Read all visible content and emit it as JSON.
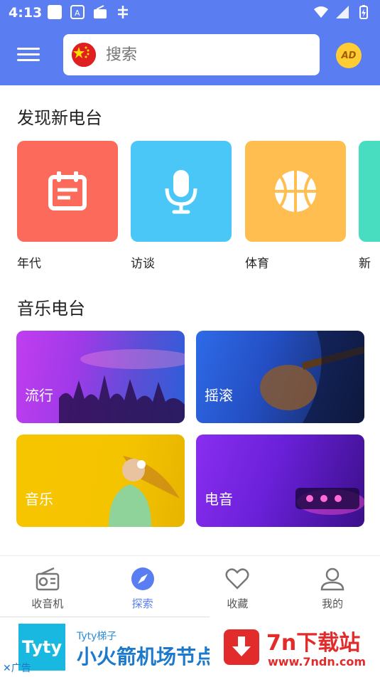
{
  "status_bar": {
    "time": "4:13"
  },
  "header": {
    "search_placeholder": "搜索",
    "ad_badge": "AD"
  },
  "discover": {
    "title": "发现新电台",
    "tiles": [
      {
        "label": "年代",
        "icon": "calendar-icon",
        "color": "#fb6a5b"
      },
      {
        "label": "访谈",
        "icon": "microphone-icon",
        "color": "#4bc7f7"
      },
      {
        "label": "体育",
        "icon": "basketball-icon",
        "color": "#ffbe4f"
      },
      {
        "label": "新闻",
        "icon": "news-icon",
        "color": "#48dcc0"
      }
    ]
  },
  "music": {
    "title": "音乐电台",
    "cards": [
      {
        "label": "流行"
      },
      {
        "label": "摇滚"
      },
      {
        "label": "音乐"
      },
      {
        "label": "电音"
      }
    ]
  },
  "bottom_nav": {
    "items": [
      {
        "label": "收音机",
        "icon": "radio-icon"
      },
      {
        "label": "探索",
        "icon": "compass-icon",
        "active": true
      },
      {
        "label": "收藏",
        "icon": "heart-icon"
      },
      {
        "label": "我的",
        "icon": "user-icon"
      }
    ]
  },
  "ad": {
    "logo": "Tyty",
    "small_text": "Tyty梯子",
    "big_text": "小火箭机场节点",
    "tag": "广告"
  },
  "watermark": {
    "title": "7n下载站",
    "url": "www.7ndn.com"
  },
  "colors": {
    "accent": "#5a7df1",
    "ad_blue": "#1d79cc",
    "watermark_red": "#e22b2b"
  }
}
